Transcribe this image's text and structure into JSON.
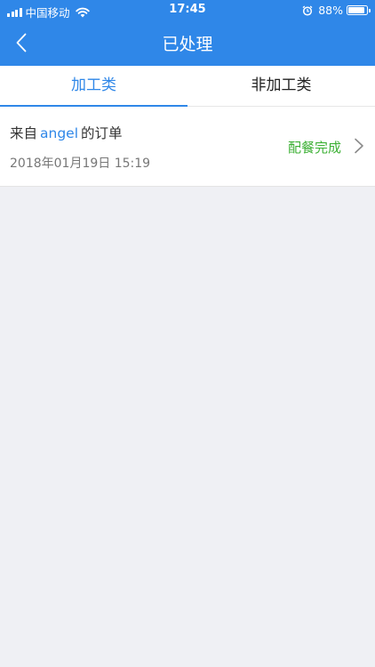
{
  "status_bar": {
    "carrier": "中国移动",
    "time": "17:45",
    "battery_pct": "88%",
    "battery_level": 0.88
  },
  "nav": {
    "title": "已处理",
    "back_icon": "chevron-left-icon"
  },
  "tabs": [
    {
      "label": "加工类",
      "active": true
    },
    {
      "label": "非加工类",
      "active": false
    }
  ],
  "orders": [
    {
      "title_prefix": "来自",
      "user": "angel",
      "title_suffix": "的订单",
      "time": "2018年01月19日 15:19",
      "status": "配餐完成"
    }
  ],
  "colors": {
    "primary": "#2f87e8",
    "status_green": "#3cb034",
    "background": "#eff0f4"
  }
}
